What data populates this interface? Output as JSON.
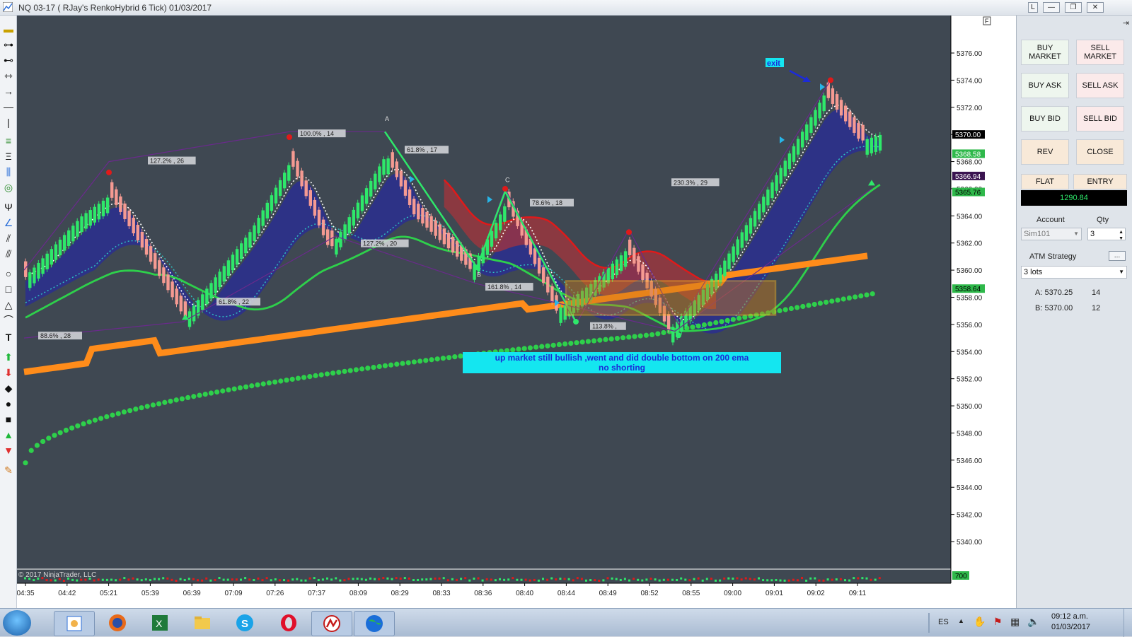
{
  "window": {
    "title": "NQ 03-17 ( RJay's RenkoHybrid  6 Tick)  01/03/2017",
    "buttons": [
      "L",
      "—",
      "❐",
      "✕"
    ]
  },
  "chart": {
    "copyright": "© 2017 NinjaTrader, LLC",
    "price_labels": [
      "5376.00",
      "5374.00",
      "5372.00",
      "5370.00",
      "5368.00",
      "5366.00",
      "5364.00",
      "5362.00",
      "5360.00",
      "5358.00",
      "5356.00",
      "5354.00",
      "5352.00",
      "5350.00",
      "5348.00",
      "5346.00",
      "5344.00",
      "5342.00",
      "5340.00"
    ],
    "time_labels": [
      "04:35",
      "04:42",
      "05:21",
      "05:39",
      "06:39",
      "07:09",
      "07:26",
      "07:37",
      "08:09",
      "08:29",
      "08:33",
      "08:36",
      "08:40",
      "08:44",
      "08:49",
      "08:52",
      "08:55",
      "09:00",
      "09:01",
      "09:02",
      "09:11"
    ],
    "price_tags": [
      {
        "text": "5370.00",
        "bg": "#000000",
        "fg": "#ffffff"
      },
      {
        "text": "5368.58",
        "bg": "#2eb84a",
        "fg": "#ffffff"
      },
      {
        "text": "5366.94",
        "bg": "#3a1350",
        "fg": "#ffffff"
      },
      {
        "text": "5365.76",
        "bg": "#2eb84a",
        "fg": "#000000"
      },
      {
        "text": "5358.64",
        "bg": "#2eb84a",
        "fg": "#000000"
      }
    ],
    "volume_tag": "700",
    "fib_labels": [
      "127.2% , 26",
      "100.0% , 14",
      "61.8% , 17",
      "78.6% , 18",
      "230.3% , 29",
      "127.2% , 20",
      "61.8% , 22",
      "88.6% , 28",
      "161.8% , 14",
      "113.8% ,"
    ],
    "point_labels": [
      "A",
      "B",
      "C"
    ],
    "exit_label": "exit",
    "note_line1": "up market still bullish ,went and did double bottom on 200 ema",
    "note_line2": "no shorting",
    "corner_button": "F",
    "colors": {
      "background": "#3f4852",
      "bull": "#2ee86a",
      "bear": "#f59a92",
      "ema_orange": "#ff8c1a",
      "ema_green_dots": "#2ed04b",
      "band_blue": "#2a2f8f",
      "band_red": "#a5343c",
      "note_bg": "#14e6f0"
    }
  },
  "panel": {
    "buy_market": "BUY MARKET",
    "sell_market": "SELL MARKET",
    "buy_ask": "BUY ASK",
    "sell_ask": "SELL ASK",
    "buy_bid": "BUY BID",
    "sell_bid": "SELL BID",
    "rev": "REV",
    "close": "CLOSE",
    "flat": "FLAT",
    "entry": "ENTRY",
    "pnl": "1290.84",
    "account_label": "Account",
    "qty_label": "Qty",
    "account_value": "Sim101",
    "qty_value": "3",
    "atm_label": "ATM Strategy",
    "atm_value": "3 lots",
    "ask_line": "A: 5370.25",
    "ask_qty": "14",
    "bid_line": "B: 5370.00",
    "bid_qty": "12"
  },
  "taskbar": {
    "lang": "ES",
    "time": "09:12 a.m.",
    "date": "01/03/2017"
  }
}
